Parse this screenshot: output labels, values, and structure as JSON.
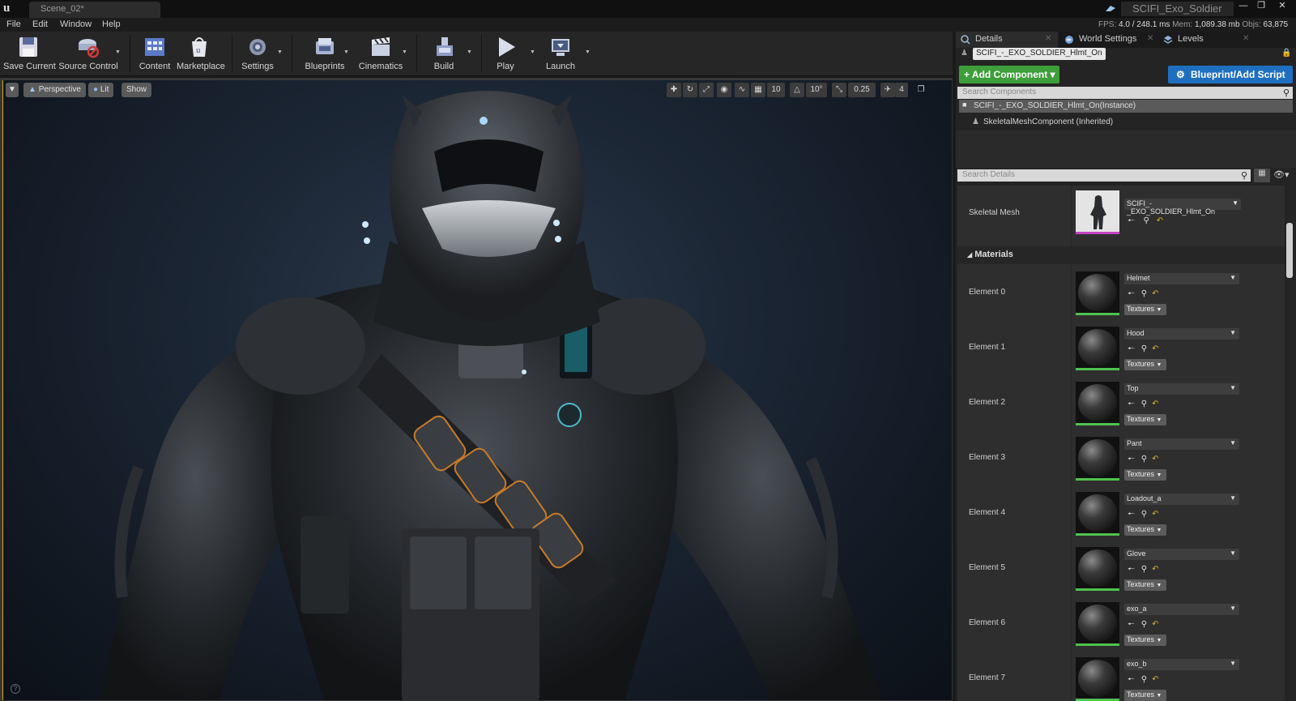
{
  "titlebar": {
    "logo": "u",
    "scene_tab": "Scene_02*",
    "app_title": "SCIFI_Exo_Soldier",
    "icons": [
      "ue-logo-icon",
      "project-icon",
      "minimize-icon",
      "maximize-icon",
      "close-icon"
    ]
  },
  "menu": {
    "items": [
      "File",
      "Edit",
      "Window",
      "Help"
    ]
  },
  "stats": {
    "fps_label": "FPS:",
    "fps_value": "4.0",
    "ms_value": "/ 248.1 ms",
    "mem_label": "Mem:",
    "mem_value": "1,089.38 mb",
    "objs_label": "Objs:",
    "objs_value": "63,875"
  },
  "toolbar": {
    "buttons": [
      {
        "label": "Save Current",
        "icon": "save-icon"
      },
      {
        "label": "Source Control",
        "icon": "source-control-icon"
      },
      {
        "label": "Content",
        "icon": "content-icon"
      },
      {
        "label": "Marketplace",
        "icon": "marketplace-icon"
      },
      {
        "label": "Settings",
        "icon": "settings-icon"
      },
      {
        "label": "Blueprints",
        "icon": "blueprints-icon"
      },
      {
        "label": "Cinematics",
        "icon": "cinematics-icon"
      },
      {
        "label": "Build",
        "icon": "build-icon"
      },
      {
        "label": "Play",
        "icon": "play-icon"
      },
      {
        "label": "Launch",
        "icon": "launch-icon"
      }
    ]
  },
  "viewport": {
    "perspective": "Perspective",
    "lit": "Lit",
    "show": "Show",
    "grid_snap": "10",
    "rot_snap": "10°",
    "scale_snap": "0.25",
    "cam_speed": "4",
    "accent_color": "#d4a21a"
  },
  "panel": {
    "tabs": [
      {
        "label": "Details",
        "icon": "details-icon"
      },
      {
        "label": "World Settings",
        "icon": "world-icon"
      },
      {
        "label": "Levels",
        "icon": "levels-icon"
      }
    ],
    "actor_name": "SCIFI_-_EXO_SOLDIER_Hlmt_On",
    "add_component": "+ Add Component ▾",
    "blueprint_script": "Blueprint/Add Script",
    "search_components_placeholder": "Search Components",
    "component_instance": "SCIFI_-_EXO_SOLDIER_Hlmt_On(Instance)",
    "component_skeletal": "SkeletalMeshComponent (Inherited)",
    "search_details_placeholder": "Search Details",
    "skeletal_mesh_label": "Skeletal Mesh",
    "skeletal_mesh_value": "SCIFI_-_EXO_SOLDIER_Hlmt_On",
    "materials_header": "Materials",
    "textures_label": "Textures",
    "add_color": "#3d9e3a",
    "blueprint_color": "#1f6fc1",
    "materials": [
      {
        "element": "Element 0",
        "material": "Helmet"
      },
      {
        "element": "Element 1",
        "material": "Hood"
      },
      {
        "element": "Element 2",
        "material": "Top"
      },
      {
        "element": "Element 3",
        "material": "Pant"
      },
      {
        "element": "Element 4",
        "material": "Loadout_a"
      },
      {
        "element": "Element 5",
        "material": "Glove"
      },
      {
        "element": "Element 6",
        "material": "exo_a"
      },
      {
        "element": "Element 7",
        "material": "exo_b"
      }
    ]
  }
}
